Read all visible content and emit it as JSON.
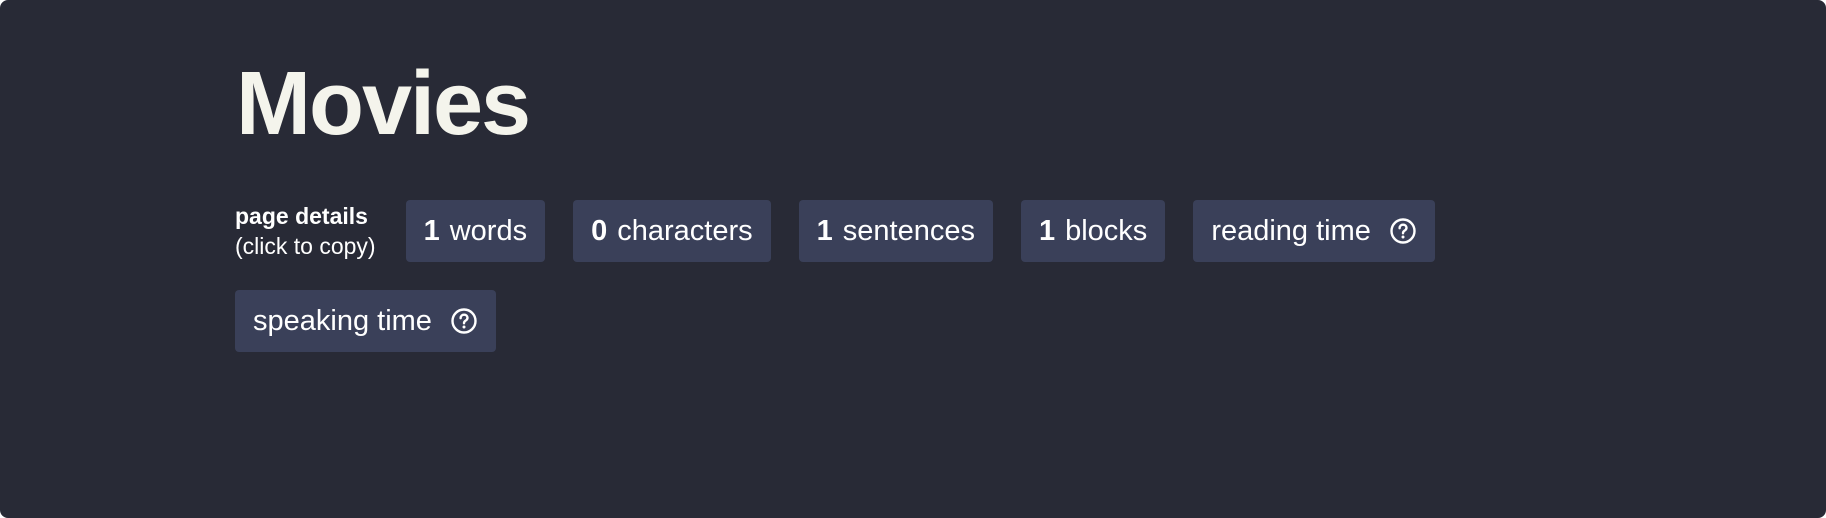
{
  "page": {
    "title": "Movies"
  },
  "details": {
    "label_line1": "page details",
    "label_line2": "(click to copy)",
    "chips": {
      "words": {
        "value": "1",
        "label": "words"
      },
      "characters": {
        "value": "0",
        "label": "characters"
      },
      "sentences": {
        "value": "1",
        "label": "sentences"
      },
      "blocks": {
        "value": "1",
        "label": "blocks"
      },
      "reading_time": {
        "label": "reading time",
        "icon": "help-circle-icon"
      },
      "speaking_time": {
        "label": "speaking time",
        "icon": "help-circle-icon"
      }
    }
  },
  "colors": {
    "background": "#282a36",
    "chip_background": "#3a4059",
    "title_text": "#f4f4ec",
    "chip_text": "#ffffff"
  }
}
